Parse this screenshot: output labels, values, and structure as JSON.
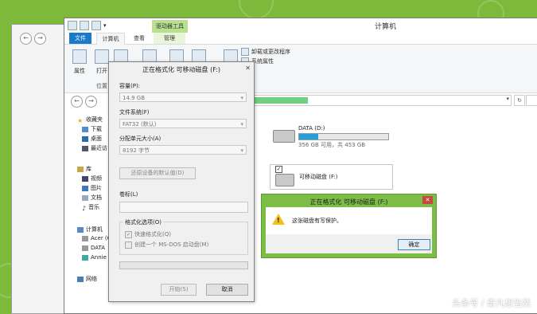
{
  "window": {
    "title": "计算机",
    "context_group": "驱动器工具"
  },
  "tabs": {
    "file": "文件",
    "computer": "计算机",
    "view": "查看",
    "manage": "管理"
  },
  "ribbon": {
    "properties": "属性",
    "open": "打开",
    "group_location": "位置",
    "uninstall": "卸载或更改程序",
    "system_props": "系统属性",
    "manage": "理"
  },
  "navpane": {
    "favorites": "收藏夹",
    "downloads": "下载",
    "desktop": "桌面",
    "recent": "最近访",
    "libraries": "库",
    "videos": "视频",
    "pictures": "图片",
    "documents": "文档",
    "music": "音乐",
    "computer": "计算机",
    "acer": "Acer (C",
    "data": "DATA",
    "annie": "Annie",
    "network": "网络"
  },
  "drives": {
    "d_name": "DATA (D:)",
    "d_info": "356 GB 可用，共 453 GB",
    "d_used_fraction": 0.21,
    "f_name": "可移动磁盘 (F:)"
  },
  "format_dialog": {
    "title": "正在格式化 可移动磁盘 (F:)",
    "close": "✕",
    "capacity_label": "容量(P):",
    "capacity_value": "14.9 GB",
    "fs_label": "文件系统(F)",
    "fs_value": "FAT32 (默认)",
    "alloc_label": "分配单元大小(A)",
    "alloc_value": "8192 字节",
    "restore_button": "还原设备的默认值(D)",
    "volume_label": "卷标(L)",
    "options_legend": "格式化选项(O)",
    "quick_format": "快速格式化(Q)",
    "msdos_disk": "创建一个 MS-DOS 启动盘(M)",
    "start_button": "开始(S)",
    "cancel_button": "取消"
  },
  "protect_dialog": {
    "title": "正在格式化 可移动磁盘 (F:)",
    "close": "✕",
    "message": "这张磁盘有写保护。",
    "ok_button": "确定"
  },
  "watermark": "头条号 / 奇凡想当然",
  "colors": {
    "background": "#7dba3c",
    "accent": "#1979ca",
    "dialog_frame": "#7cbd45",
    "progress": "#71cf81"
  }
}
